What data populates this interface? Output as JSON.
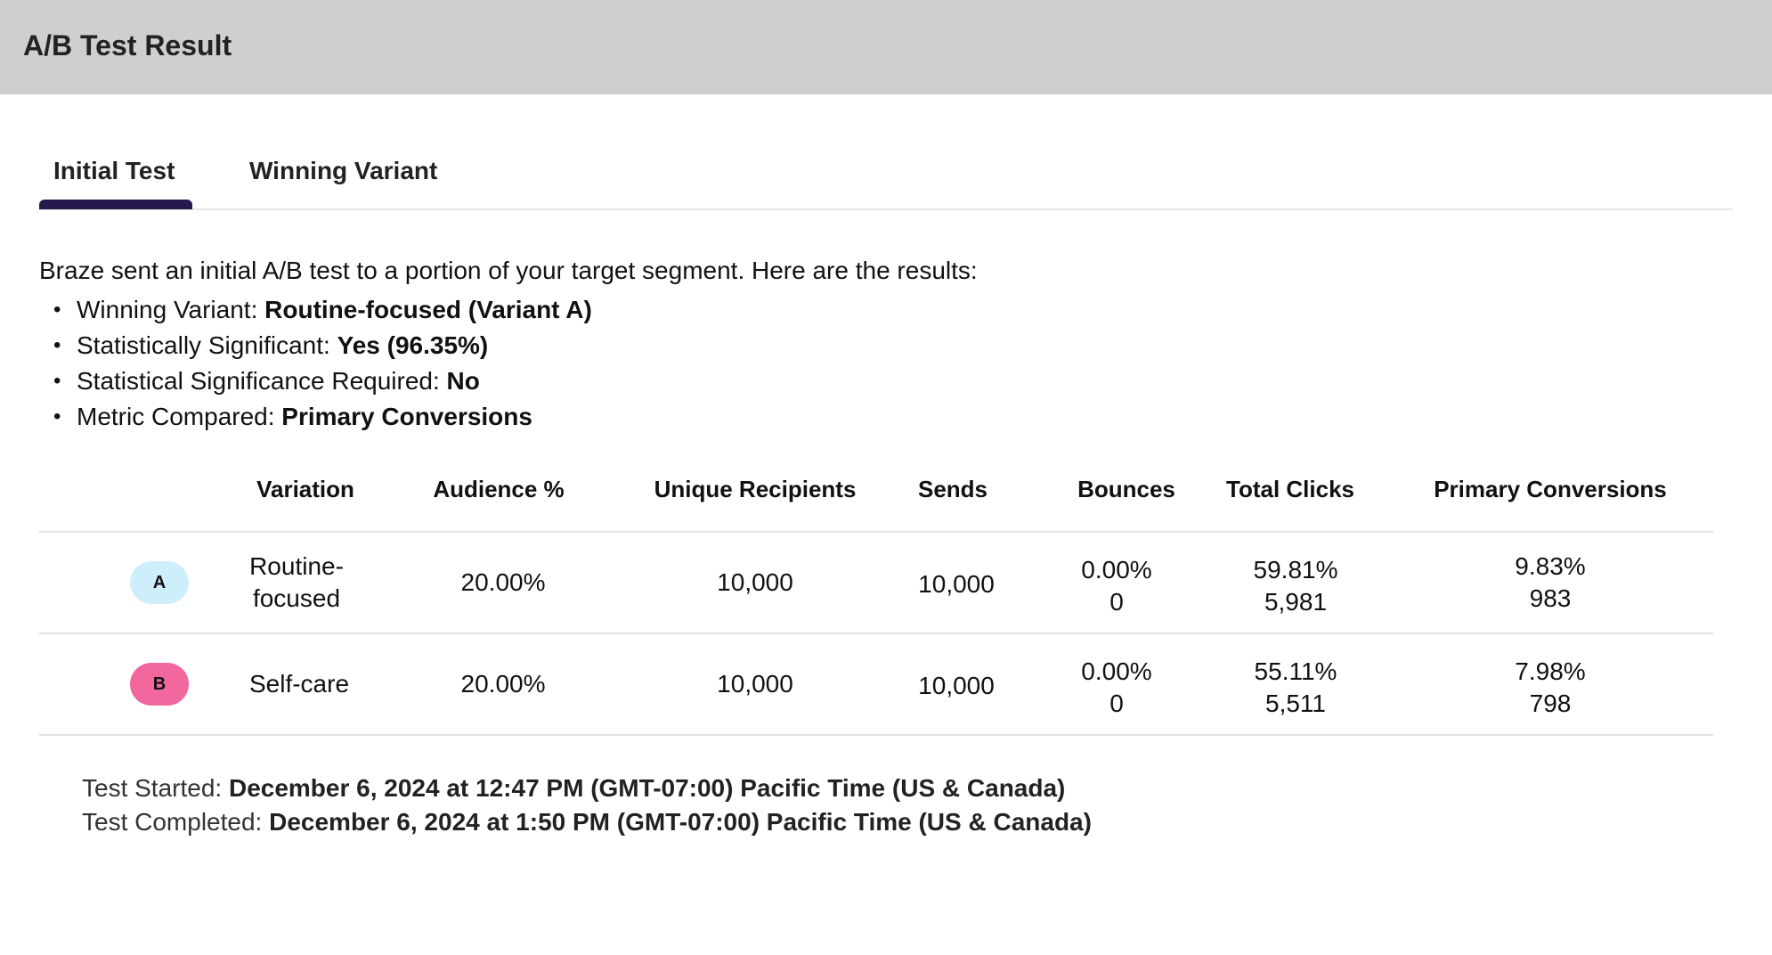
{
  "header": {
    "title": "A/B Test Result"
  },
  "tabs": [
    {
      "label": "Initial Test",
      "active": true
    },
    {
      "label": "Winning Variant",
      "active": false
    }
  ],
  "summary": {
    "intro": "Braze sent an initial A/B test to a portion of your target segment. Here are the results:",
    "bullets": [
      {
        "label": "Winning Variant: ",
        "value": "Routine-focused (Variant A)"
      },
      {
        "label": "Statistically Significant: ",
        "value": "Yes (96.35%)"
      },
      {
        "label": "Statistical Significance Required: ",
        "value": "No"
      },
      {
        "label": "Metric Compared: ",
        "value": "Primary Conversions"
      }
    ]
  },
  "table": {
    "columns": [
      "Variation",
      "Audience %",
      "Unique Recipients",
      "Sends",
      "Bounces",
      "Total Clicks",
      "Primary Conversions"
    ],
    "rows": [
      {
        "badge": "A",
        "variation_line1": "Routine-",
        "variation_line2": "focused",
        "audience": "20.00%",
        "unique_recipients": "10,000",
        "sends": "10,000",
        "bounces_pct": "0.00%",
        "bounces_count": "0",
        "clicks_pct": "59.81%",
        "clicks_count": "5,981",
        "conv_pct": "9.83%",
        "conv_count": "983"
      },
      {
        "badge": "B",
        "variation_line1": "Self-care",
        "variation_line2": "",
        "audience": "20.00%",
        "unique_recipients": "10,000",
        "sends": "10,000",
        "bounces_pct": "0.00%",
        "bounces_count": "0",
        "clicks_pct": "55.11%",
        "clicks_count": "5,511",
        "conv_pct": "7.98%",
        "conv_count": "798"
      }
    ]
  },
  "footer": {
    "started_label": "Test Started: ",
    "started_value": "December 6, 2024 at 12:47 PM (GMT-07:00) Pacific Time (US & Canada)",
    "completed_label": "Test Completed: ",
    "completed_value": "December 6, 2024 at 1:50 PM (GMT-07:00) Pacific Time (US & Canada)"
  },
  "colors": {
    "header_bg": "#cfcfd1",
    "tab_indicator": "#24194a",
    "badge_a": "#cfeefb",
    "badge_b": "#f2679e"
  }
}
